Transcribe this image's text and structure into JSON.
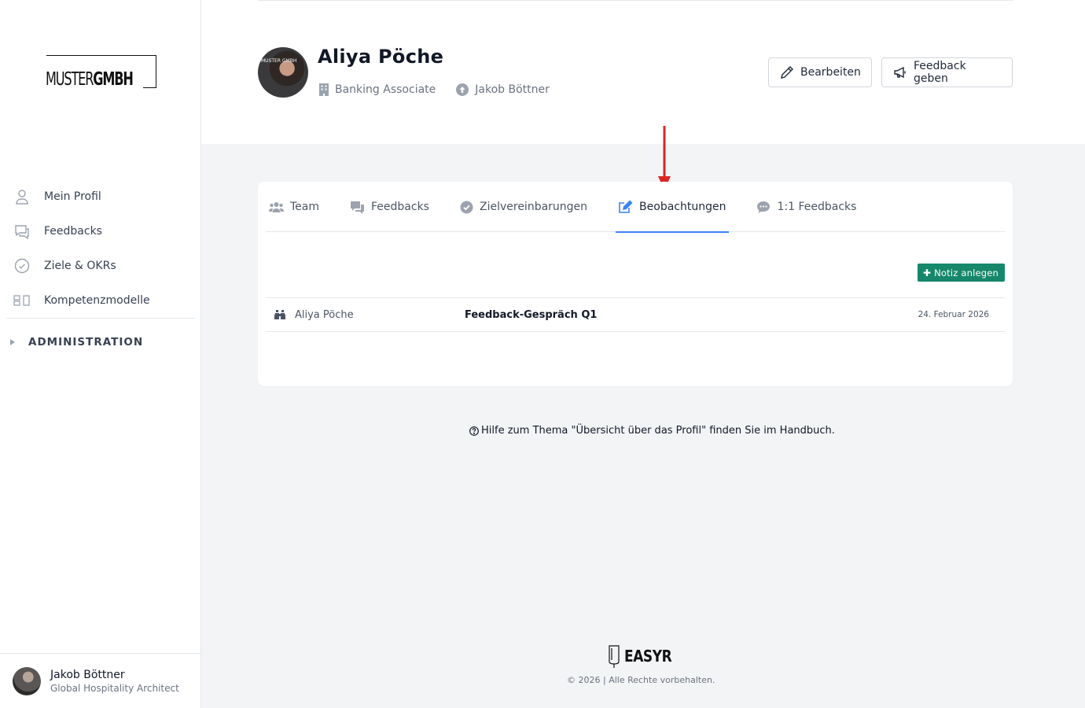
{
  "brand": {
    "logo_light": "MUSTER",
    "logo_bold": "GMBH"
  },
  "sidebar": {
    "items": [
      {
        "label": "Mein Profil",
        "icon": "user-icon"
      },
      {
        "label": "Feedbacks",
        "icon": "chat-icon"
      },
      {
        "label": "Ziele & OKRs",
        "icon": "check-circle-icon"
      },
      {
        "label": "Kompetenzmodelle",
        "icon": "blocks-icon"
      }
    ],
    "admin_label": "ADMINISTRATION",
    "user": {
      "name": "Jakob Böttner",
      "role": "Global Hospitality Architect"
    }
  },
  "profile": {
    "name": "Aliya Pöche",
    "position": "Banking Associate",
    "manager": "Jakob Böttner",
    "avatar_badge": "MUSTER GMBH"
  },
  "actions": {
    "edit": "Bearbeiten",
    "feedback": "Feedback geben"
  },
  "tabs": [
    {
      "label": "Team",
      "icon": "users-icon"
    },
    {
      "label": "Feedbacks",
      "icon": "comments-icon"
    },
    {
      "label": "Zielvereinbarungen",
      "icon": "check-circle-icon"
    },
    {
      "label": "Beobachtungen",
      "icon": "edit-icon",
      "active": true
    },
    {
      "label": "1:1 Feedbacks",
      "icon": "comment-dots-icon"
    }
  ],
  "notes": {
    "add_label": "Notiz anlegen",
    "rows": [
      {
        "author": "Aliya Pöche",
        "title": "Feedback-Gespräch Q1",
        "date": "24. Februar 2026"
      }
    ]
  },
  "help_text": "Hilfe zum Thema \"Übersicht über das Profil\" finden Sie im Handbuch.",
  "footer": {
    "brand": "EASYR",
    "copyright": "© 2026 | Alle Rechte vorbehalten."
  },
  "colors": {
    "accent": "#3b82f6",
    "note_button": "#16876a",
    "arrow": "#dc2626"
  }
}
